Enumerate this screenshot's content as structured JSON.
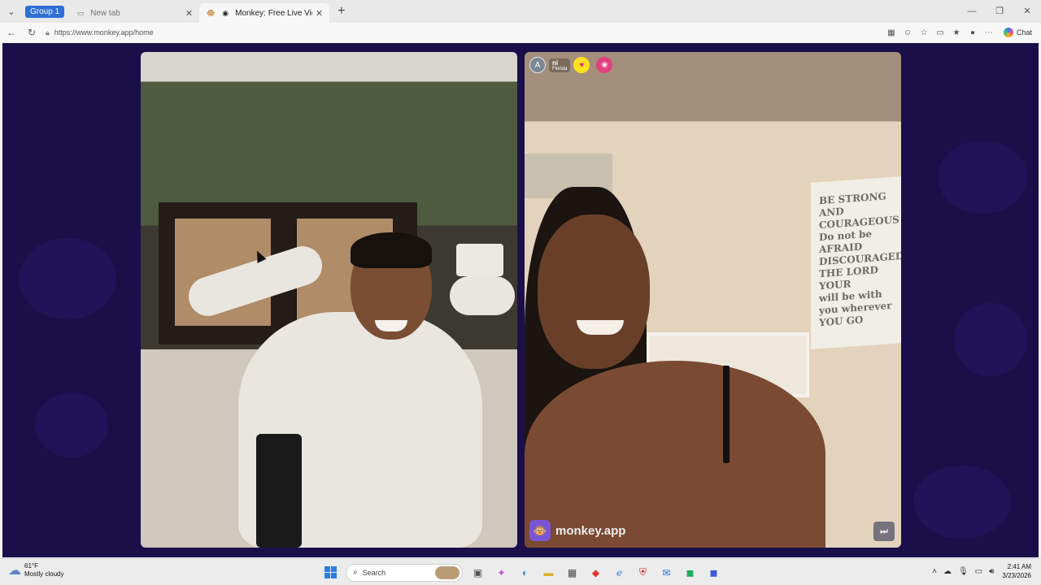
{
  "browser": {
    "group_label": "Group 1",
    "tabs": [
      {
        "title": "New tab"
      },
      {
        "title": "Monkey: Free Live Video Chat"
      }
    ],
    "url": "https://www.monkey.app/home",
    "chat_label": "Chat"
  },
  "call": {
    "remote_user": {
      "avatar_letter": "A",
      "name": "ni",
      "location": "Florida"
    },
    "canvas_text": [
      "BE STRONG",
      "AND",
      "COURAGEOUS",
      "Do not be AFRAID",
      "DISCOURAGED",
      "THE LORD",
      "YOUR",
      "will be with",
      "you wherever",
      "YOU GO"
    ],
    "watermark_text": "monkey.app",
    "colors": {
      "background": "#1b0f4a",
      "brand": "#7a54d6"
    }
  },
  "taskbar": {
    "weather_temp": "61°F",
    "weather_desc": "Mostly cloudy",
    "search_label": "Search",
    "time": "2:41 AM",
    "date": "3/23/2026"
  }
}
